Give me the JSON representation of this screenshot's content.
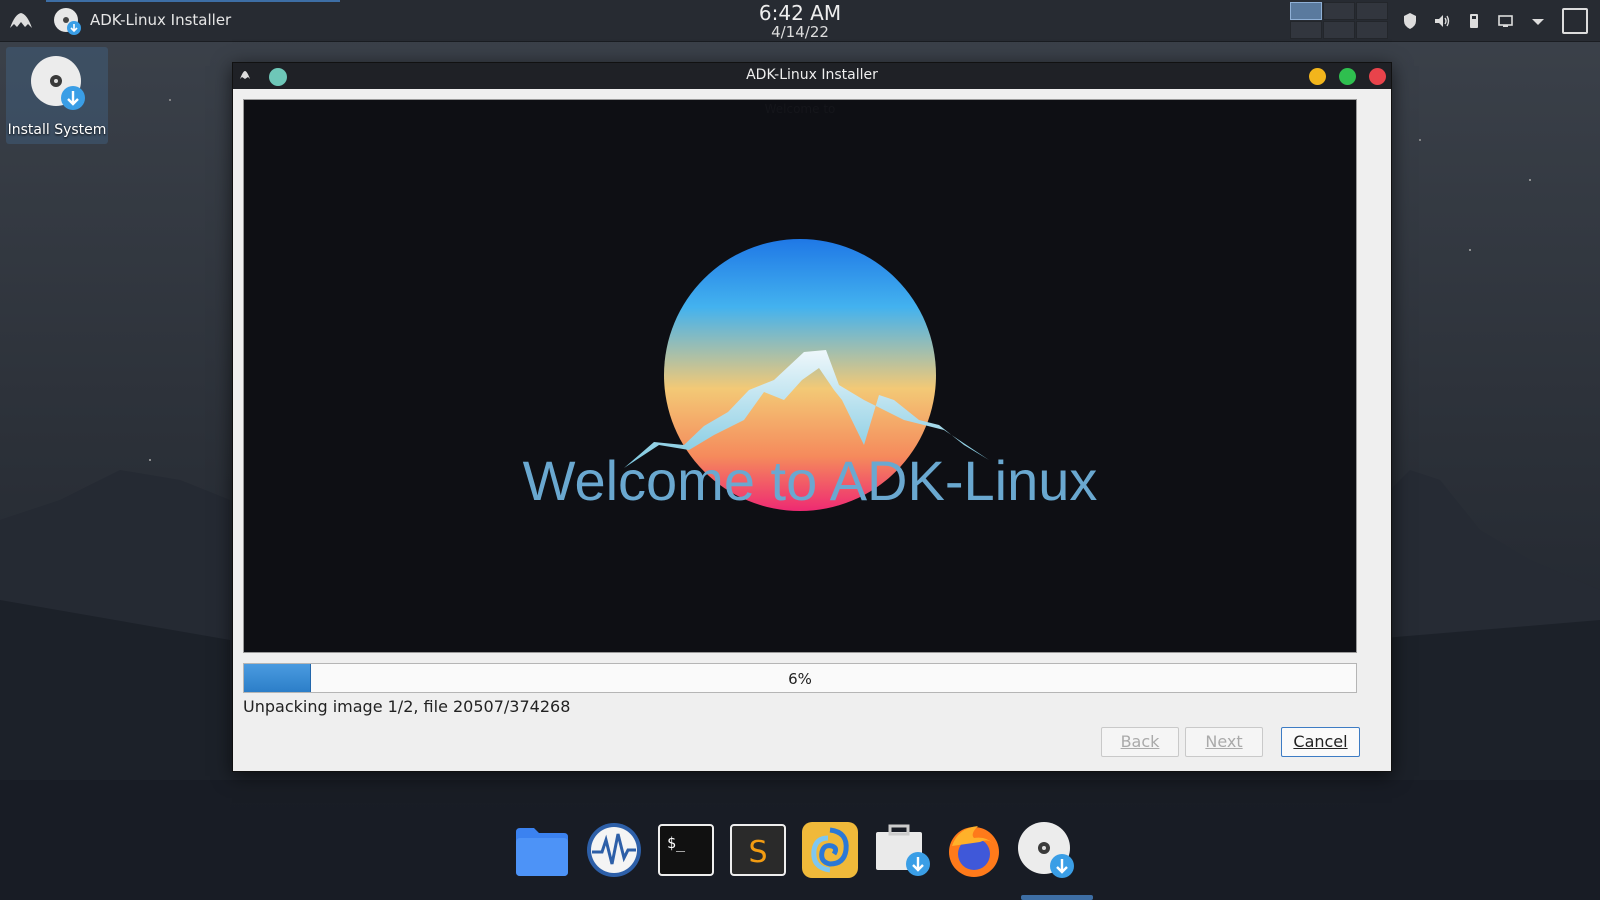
{
  "top_panel": {
    "task_title": "ADK-Linux Installer",
    "clock_time": "6:42 AM",
    "clock_date": "4/14/22"
  },
  "desktop": {
    "icons": [
      {
        "label": "Install System",
        "icon": "installer-disc-icon"
      }
    ]
  },
  "window": {
    "title": "ADK-Linux Installer",
    "slide": {
      "header_text": "Welcome to",
      "headline": "Welcome to ADK-Linux"
    },
    "progress": {
      "percent": 6,
      "label": "6%"
    },
    "status": "Unpacking image 1/2, file 20507/374268",
    "buttons": {
      "back": "Back",
      "next": "Next",
      "cancel": "Cancel"
    }
  },
  "dock": {
    "items": [
      "file-manager-icon",
      "system-monitor-icon",
      "terminal-icon",
      "sublime-text-icon",
      "swirl-app-icon",
      "software-installer-icon",
      "firefox-icon",
      "installer-disc-icon"
    ]
  },
  "colors": {
    "accent": "#3d6ea5",
    "progress_fill": "#2c7ec8",
    "close": "#e8434b",
    "minimize": "#f2b51c",
    "maximize": "#2fbf4f",
    "headline": "#6aa8d0"
  }
}
